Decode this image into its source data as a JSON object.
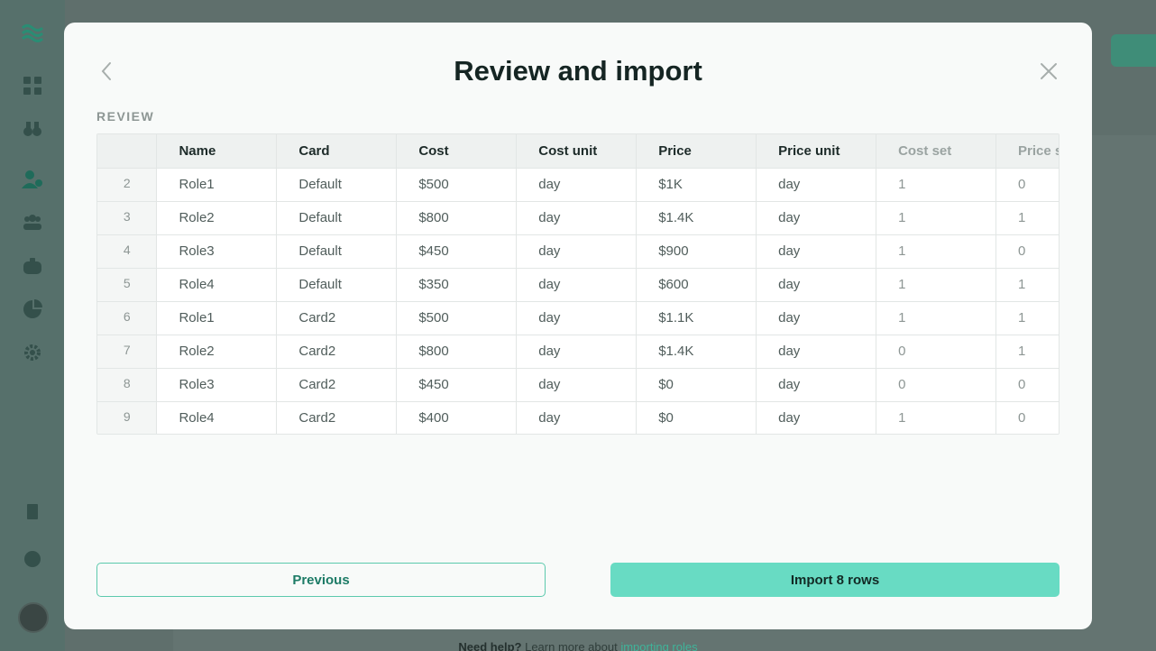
{
  "modal": {
    "title": "Review and import",
    "section_label": "REVIEW",
    "table": {
      "columns": [
        {
          "label": "Name",
          "muted": false
        },
        {
          "label": "Card",
          "muted": false
        },
        {
          "label": "Cost",
          "muted": false
        },
        {
          "label": "Cost unit",
          "muted": false
        },
        {
          "label": "Price",
          "muted": false
        },
        {
          "label": "Price unit",
          "muted": false
        },
        {
          "label": "Cost set",
          "muted": true
        },
        {
          "label": "Price set",
          "muted": true
        }
      ],
      "rows": [
        {
          "index": "2",
          "cells": [
            "Role1",
            "Default",
            "$500",
            "day",
            "$1K",
            "day",
            "1",
            "0"
          ]
        },
        {
          "index": "3",
          "cells": [
            "Role2",
            "Default",
            "$800",
            "day",
            "$1.4K",
            "day",
            "1",
            "1"
          ]
        },
        {
          "index": "4",
          "cells": [
            "Role3",
            "Default",
            "$450",
            "day",
            "$900",
            "day",
            "1",
            "0"
          ]
        },
        {
          "index": "5",
          "cells": [
            "Role4",
            "Default",
            "$350",
            "day",
            "$600",
            "day",
            "1",
            "1"
          ]
        },
        {
          "index": "6",
          "cells": [
            "Role1",
            "Card2",
            "$500",
            "day",
            "$1.1K",
            "day",
            "1",
            "1"
          ]
        },
        {
          "index": "7",
          "cells": [
            "Role2",
            "Card2",
            "$800",
            "day",
            "$1.4K",
            "day",
            "0",
            "1"
          ]
        },
        {
          "index": "8",
          "cells": [
            "Role3",
            "Card2",
            "$450",
            "day",
            "$0",
            "day",
            "0",
            "0"
          ]
        },
        {
          "index": "9",
          "cells": [
            "Role4",
            "Card2",
            "$400",
            "day",
            "$0",
            "day",
            "1",
            "0"
          ]
        }
      ]
    },
    "buttons": {
      "previous": "Previous",
      "import": "Import 8 rows"
    }
  },
  "background": {
    "help_prefix": "Need help?",
    "help_text": "Learn more about",
    "help_link": "importing roles"
  },
  "colors": {
    "accent": "#68dbc3",
    "accent_dark": "#1d7b66",
    "overlay": "#5e716d"
  }
}
